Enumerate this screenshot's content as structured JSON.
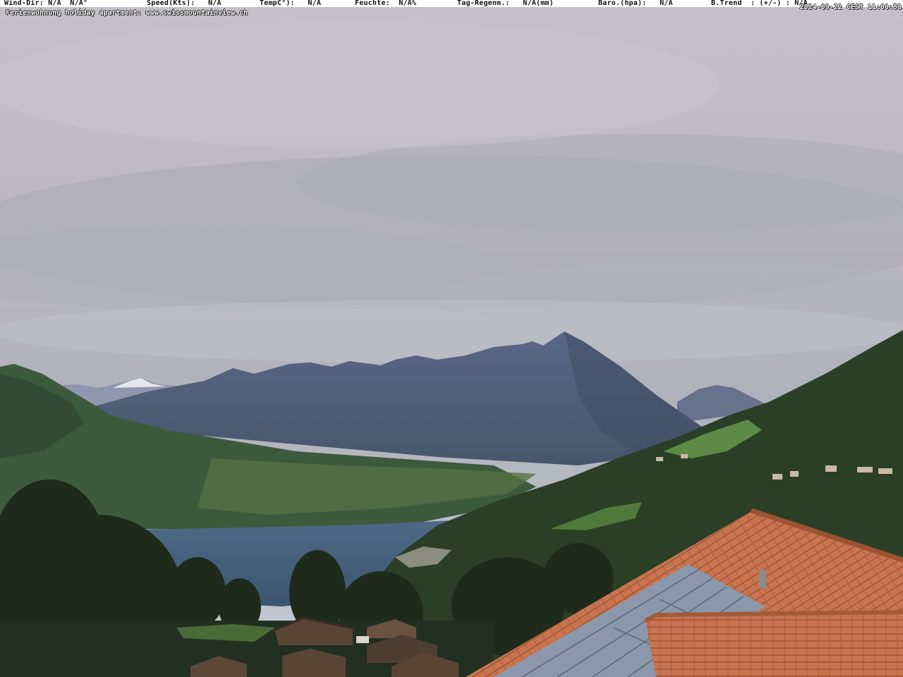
{
  "overlay": {
    "wind_dir": "Wind-Dir: N/A  N/A°",
    "speed": "Speed(Kts):   N/A",
    "temp": "TempC°):   N/A",
    "humidity": "Feuchte:  N/A%",
    "rain": "Tag-Regenm.:   N/A(mm)",
    "baro": "Baro.(hpa):   N/A",
    "trend": "B.Trend  : (+/-) : N/A",
    "subtitle": "Ferienwohnung holiday apartment: www.swissmountainview.ch",
    "timestamp": "2024-09-22 CEST 11:00:58"
  },
  "scene": {
    "subject": "webcam-view",
    "colors": {
      "sky_top": "#c9c5cf",
      "sky_cloud": "#9fa3ac",
      "mountain_far": "#5a6685",
      "mountain_main": "#4b5878",
      "valley_green": "#3e5a3b",
      "lake": "#44607c",
      "forest": "#22331f",
      "roof_tile": "#c7714a",
      "solar_panel": "#8e9bb0"
    }
  }
}
